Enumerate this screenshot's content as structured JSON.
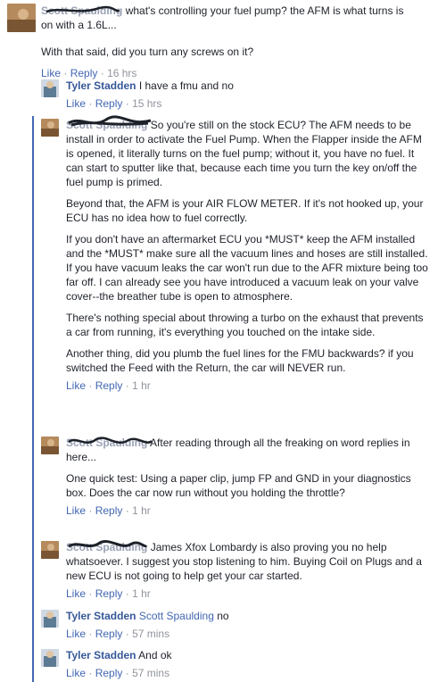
{
  "top_comment": {
    "author": "Scott Spaulding",
    "text_head": "what's controlling your fuel pump? the AFM is what turns is on with a 1.6L...",
    "text_para2": "With that said, did you turn any screws on it?",
    "like": "Like",
    "reply": "Reply",
    "time": "16 hrs"
  },
  "replies": [
    {
      "author": "Tyler Stadden",
      "text": "I have a fmu and no",
      "like": "Like",
      "reply": "Reply",
      "time": "15 hrs"
    },
    {
      "author": "Scott Spaulding",
      "paragraphs": [
        "So you're still on the stock ECU? The AFM needs to be install in order to activate the Fuel Pump. When the Flapper inside the AFM is opened, it literally turns on the fuel pump; without it, you have no fuel. It can start to sputter like that, because each time you turn the key on/off the fuel pump is primed.",
        "Beyond that, the AFM is your AIR FLOW METER. If it's not hooked up, your ECU has no idea how to fuel correctly.",
        "If you don't have an aftermarket ECU you *MUST* keep the AFM installed and the *MUST* make sure all the vacuum lines and hoses are still installed. If you have vacuum leaks the car won't run due to the AFR mixture being too far off. I can already see you have introduced a vacuum leak on your valve cover--the breather tube is open to atmosphere.",
        "There's nothing special about throwing a turbo on the exhaust that prevents a car from running, it's everything you touched on the intake side.",
        "Another thing, did you plumb the fuel lines for the FMU backwards? if you switched the Feed with the Return, the car will NEVER run."
      ],
      "like": "Like",
      "reply": "Reply",
      "time": "1 hr"
    },
    {
      "author": "Scott Spaulding",
      "paragraphs": [
        "After reading through all the freaking on word replies in here...",
        "One quick test: Using a paper clip, jump FP and GND in your diagnostics box. Does the car now run without you holding the throttle?"
      ],
      "like": "Like",
      "reply": "Reply",
      "time": "1 hr"
    },
    {
      "author": "Scott Spaulding",
      "paragraphs": [
        "James Xfox Lombardy is also proving you no help whatsoever. I suggest you stop listening to him. Buying Coil on Plugs and a new ECU is not going to help get your car started."
      ],
      "like": "Like",
      "reply": "Reply",
      "time": "1 hr"
    },
    {
      "author": "Tyler Stadden",
      "mention": "Scott Spaulding",
      "text": "no",
      "like": "Like",
      "reply": "Reply",
      "time": "57 mins"
    },
    {
      "author": "Tyler Stadden",
      "text": "And ok",
      "like": "Like",
      "reply": "Reply",
      "time": "57 mins"
    }
  ],
  "colors": {
    "link": "#4267b2",
    "name": "#365899",
    "meta": "#90949c",
    "text": "#1d2129"
  }
}
